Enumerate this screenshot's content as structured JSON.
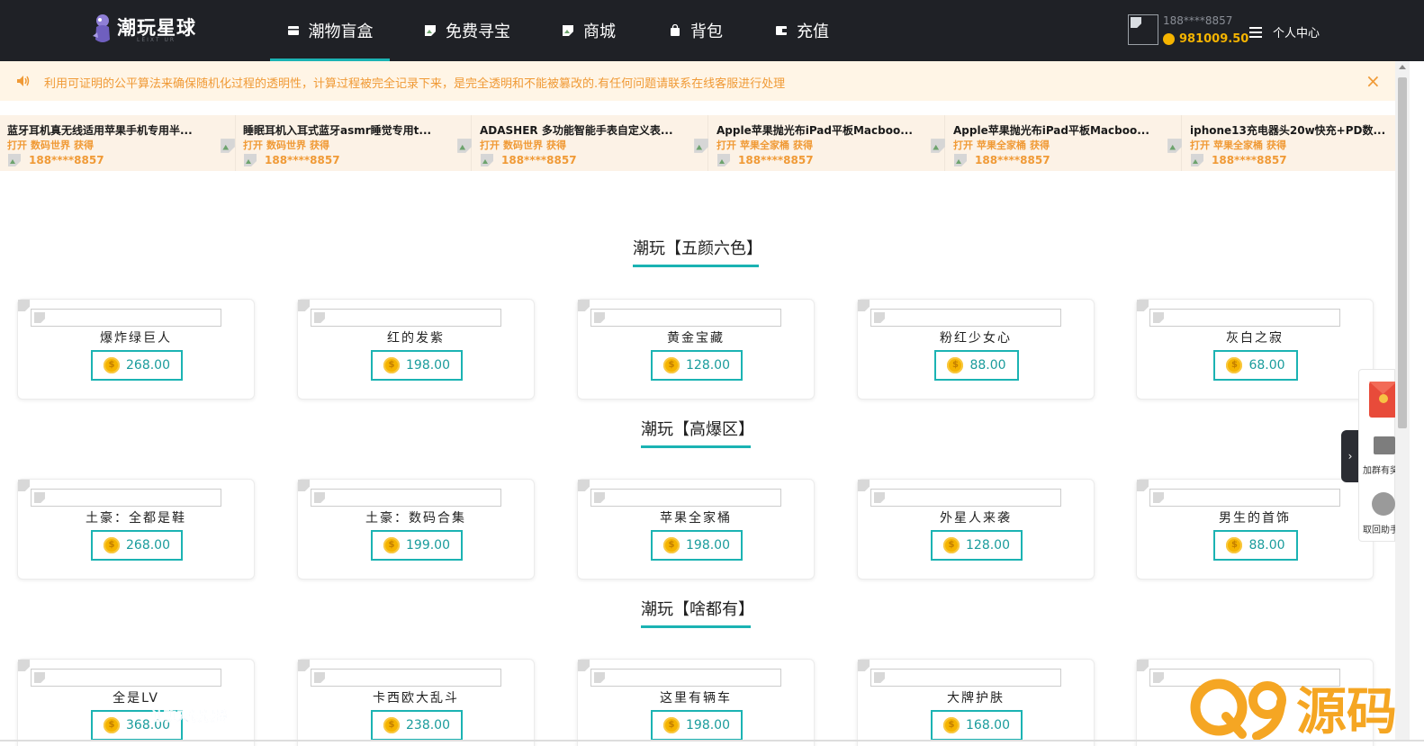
{
  "header": {
    "logo_text": "潮玩星球",
    "logo_sub": "LEIXT UR",
    "nav": [
      {
        "label": "潮物盲盒",
        "icon": "box-icon",
        "active": true
      },
      {
        "label": "免费寻宝",
        "icon": "broken-image-icon",
        "active": false
      },
      {
        "label": "商城",
        "icon": "broken-image-icon",
        "active": false
      },
      {
        "label": "背包",
        "icon": "bag-icon",
        "active": false
      },
      {
        "label": "充值",
        "icon": "wallet-icon",
        "active": false
      }
    ],
    "user": {
      "phone": "188****8857",
      "balance": "981009.50",
      "center_label": "个人中心"
    }
  },
  "notice": {
    "text": "利用可证明的公平算法来确保随机化过程的透明性，计算过程被完全记录下来，是完全透明和不能被篡改的.有任何问题请联系在线客服进行处理",
    "close": "×"
  },
  "ticker": [
    {
      "title": "蓝牙耳机真无线适用苹果手机专用半...",
      "open": "打开",
      "box": "数码世界",
      "get": "获得",
      "user": "188****8857"
    },
    {
      "title": "睡眠耳机入耳式蓝牙asmr睡觉专用t...",
      "open": "打开",
      "box": "数码世界",
      "get": "获得",
      "user": "188****8857"
    },
    {
      "title": "ADASHER 多功能智能手表自定义表...",
      "open": "打开",
      "box": "数码世界",
      "get": "获得",
      "user": "188****8857"
    },
    {
      "title": "Apple苹果抛光布iPad平板Macboo...",
      "open": "打开",
      "box": "苹果全家桶",
      "get": "获得",
      "user": "188****8857"
    },
    {
      "title": "Apple苹果抛光布iPad平板Macboo...",
      "open": "打开",
      "box": "苹果全家桶",
      "get": "获得",
      "user": "188****8857"
    },
    {
      "title": "iphone13充电器头20w快充+PD数...",
      "open": "打开",
      "box": "苹果全家桶",
      "get": "获得",
      "user": "188****8857"
    }
  ],
  "sections": [
    {
      "title": "潮玩【五颜六色】",
      "items": [
        {
          "name": "爆炸绿巨人",
          "price": "268.00"
        },
        {
          "name": "红的发紫",
          "price": "198.00"
        },
        {
          "name": "黄金宝藏",
          "price": "128.00"
        },
        {
          "name": "粉红少女心",
          "price": "88.00"
        },
        {
          "name": "灰白之寂",
          "price": "68.00"
        }
      ]
    },
    {
      "title": "潮玩【高爆区】",
      "items": [
        {
          "name": "土豪：全都是鞋",
          "price": "268.00"
        },
        {
          "name": "土豪：数码合集",
          "price": "199.00"
        },
        {
          "name": "苹果全家桶",
          "price": "198.00"
        },
        {
          "name": "外星人来袭",
          "price": "128.00"
        },
        {
          "name": "男生的首饰",
          "price": "88.00"
        }
      ]
    },
    {
      "title": "潮玩【啥都有】",
      "items": [
        {
          "name": "全是LV",
          "price": "368.00"
        },
        {
          "name": "卡西欧大乱斗",
          "price": "238.00"
        },
        {
          "name": "这里有辆车",
          "price": "198.00"
        },
        {
          "name": "大牌护肤",
          "price": "168.00"
        },
        {
          "name": "",
          "price": ""
        }
      ]
    }
  ],
  "float_panel": {
    "group_label": "加群有奖",
    "helper_label": "取回助手",
    "tab_arrow": "›"
  },
  "watermarks": {
    "chat": "让聊天慢慢摇",
    "brand": "Q9源码"
  },
  "colors": {
    "topbar": "#1f2126",
    "accent": "#1bb3b3",
    "coin": "#f5b400",
    "notice_text": "#f09a36",
    "notice_bg": "#fff5e6"
  }
}
